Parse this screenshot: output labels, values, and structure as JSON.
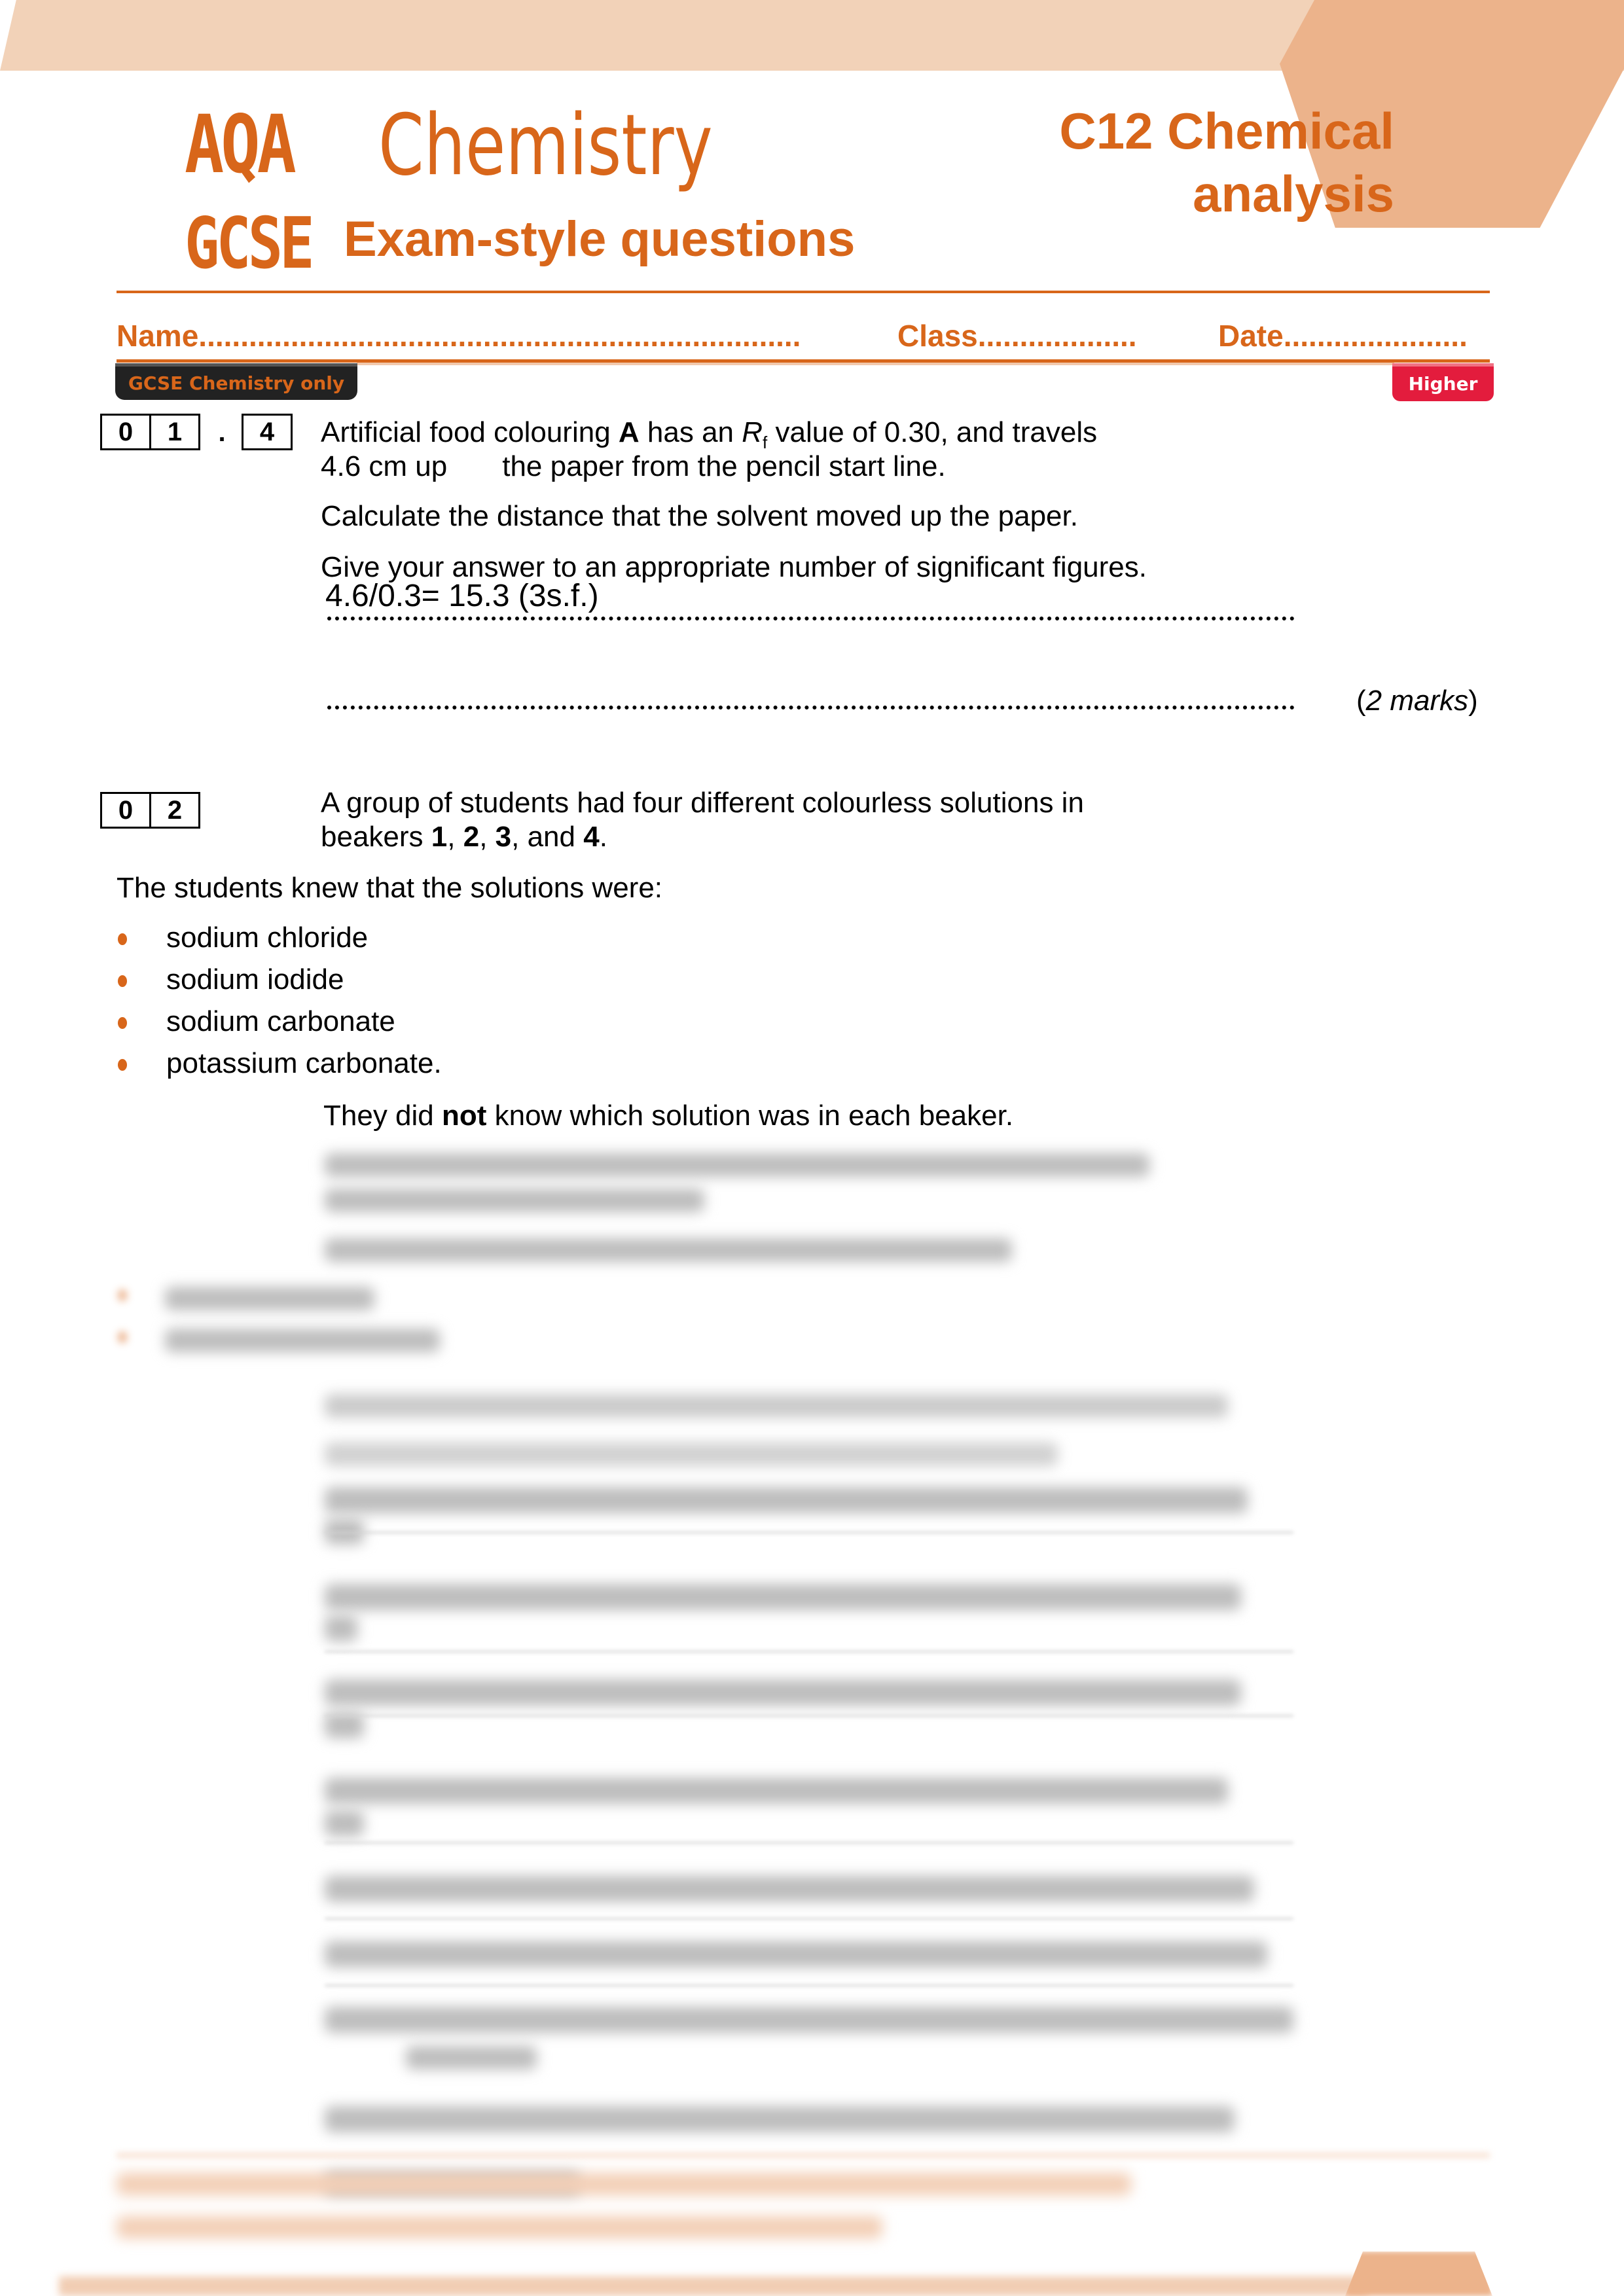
{
  "header": {
    "brand_line1_bold": "AQA",
    "brand_line1_light": "Chemistry",
    "brand_line2_bold": "GCSE",
    "brand_line2_sub": "Exam-style questions",
    "chapter_line1": "C12 Chemical",
    "chapter_line2": "analysis"
  },
  "student_fields": {
    "name_label": "Name........................................................................",
    "class_label": "Class...................",
    "date_label": "Date......................"
  },
  "tags": {
    "left": "GCSE Chemistry only",
    "right": "Higher"
  },
  "question_1": {
    "number_cells": [
      "0",
      "1"
    ],
    "separator": ".",
    "part_cell": "4",
    "stem_line1_pre": "Artificial food colouring ",
    "stem_bold_A": "A",
    "stem_line1_mid": " has an ",
    "stem_italic_R": "R",
    "stem_sub_f": "f",
    "stem_line1_post": " value of 0.30, and travels",
    "stem_line2_a": "4.6 cm up",
    "stem_line2_b": "the paper from the pencil start line.",
    "instruction_1": "Calculate the distance that the solvent moved up the paper.",
    "instruction_2": "Give your answer to an appropriate number of significant figures.",
    "answer": "4.6/0.3= 15.3 (3s.f.)",
    "marks_open": "(",
    "marks_italic": "2 marks",
    "marks_close": ")"
  },
  "question_2": {
    "number_cells": [
      "0",
      "2"
    ],
    "stem_line1": "A group of students had four different colourless solutions in",
    "stem_line2_pre": "beakers ",
    "b1": "1",
    "c1": ", ",
    "b2": "2",
    "c2": ", ",
    "b3": "3",
    "c3": ", and ",
    "b4": "4",
    "end": ".",
    "intro": "The students knew that the solutions were:",
    "solutions": [
      "sodium chloride",
      "sodium iodide",
      "sodium carbonate",
      "potassium carbonate."
    ],
    "note_pre": "They did ",
    "note_bold": "not",
    "note_post": " know which solution was in each beaker."
  },
  "colors": {
    "accent_orange": "#d8661a",
    "band_light": "#f2d2b8",
    "hexagon": "#ecb38b",
    "higher_red": "#e31c3d",
    "tag_dark": "#222222"
  }
}
